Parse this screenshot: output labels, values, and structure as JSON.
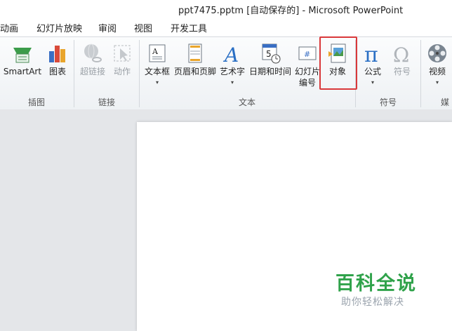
{
  "window": {
    "title": "ppt7475.pptm [自动保存的] - Microsoft PowerPoint"
  },
  "tabs": [
    {
      "label": "动画"
    },
    {
      "label": "幻灯片放映"
    },
    {
      "label": "审阅"
    },
    {
      "label": "视图"
    },
    {
      "label": "开发工具"
    }
  ],
  "ribbon": {
    "groups": {
      "illustrations": {
        "label": "插图",
        "buttons": {
          "smartart": "SmartArt",
          "chart": "图表"
        }
      },
      "links": {
        "label": "链接",
        "buttons": {
          "hyperlink": "超链接",
          "action": "动作"
        }
      },
      "text": {
        "label": "文本",
        "buttons": {
          "textbox": "文本框",
          "header_footer": "页眉和页脚",
          "wordart": "艺术字",
          "date_time": "日期和时间",
          "slide_number_line1": "幻灯片",
          "slide_number_line2": "编号",
          "object": "对象"
        }
      },
      "symbols": {
        "label": "符号",
        "buttons": {
          "equation": "公式",
          "symbol": "符号"
        }
      },
      "media": {
        "label": "媒",
        "buttons": {
          "video": "视频"
        }
      }
    }
  },
  "watermark": {
    "brand": "百科全说",
    "tagline": "助你轻松解决"
  },
  "colors": {
    "highlight": "#d9383a",
    "watermark_green": "#2fa24a",
    "ribbon_bg": "#f3f5f7"
  }
}
